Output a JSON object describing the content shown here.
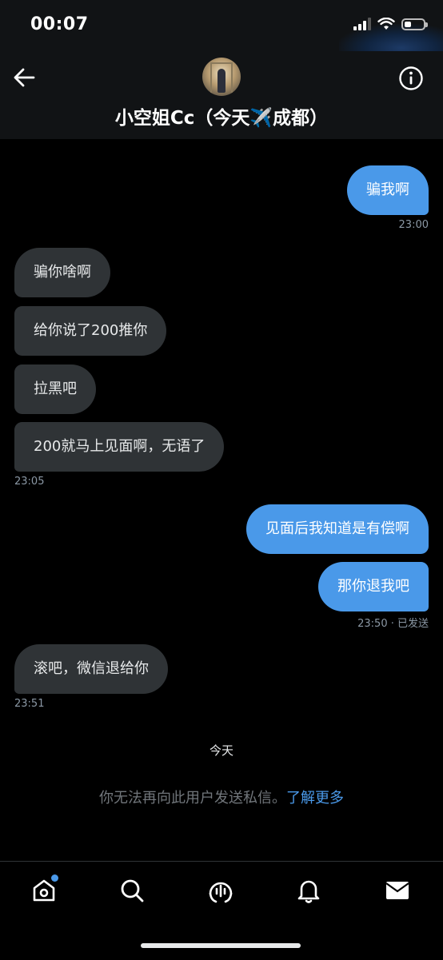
{
  "status_bar": {
    "time": "00:07",
    "signal_icon": "signal-bars-icon",
    "wifi_icon": "wifi-icon",
    "battery_icon": "battery-icon",
    "battery_level": 0.35
  },
  "header": {
    "back_icon": "arrow-left-icon",
    "avatar": "user-avatar",
    "title": "小空姐Cc（今天✈️成都）",
    "info_icon": "info-circle-icon"
  },
  "messages": [
    {
      "side": "out",
      "text": "骗我啊"
    },
    {
      "side": "out_ts",
      "text": "23:00"
    },
    {
      "side": "in",
      "text": "骗你啥啊"
    },
    {
      "side": "in",
      "text": "给你说了200推你"
    },
    {
      "side": "in",
      "text": "拉黑吧"
    },
    {
      "side": "in",
      "text": "200就马上见面啊，无语了"
    },
    {
      "side": "in_ts",
      "text": "23:05"
    },
    {
      "side": "out",
      "text": "见面后我知道是有偿啊"
    },
    {
      "side": "out",
      "text": "那你退我吧"
    },
    {
      "side": "out_ts",
      "text": "23:50 · 已发送"
    },
    {
      "side": "in",
      "text": "滚吧，微信退给你"
    },
    {
      "side": "in_ts",
      "text": "23:51"
    }
  ],
  "day_label": "今天",
  "notice": {
    "text": "你无法再向此用户发送私信。",
    "link": "了解更多"
  },
  "tab_bar": {
    "tabs": [
      "home-icon",
      "search-icon",
      "spaces-icon",
      "bell-icon",
      "mail-icon"
    ],
    "accent": "#4a99e9"
  },
  "colors": {
    "incoming_bubble": "#2f3336",
    "outgoing_bubble": "#4a99e9",
    "background": "#000000"
  }
}
